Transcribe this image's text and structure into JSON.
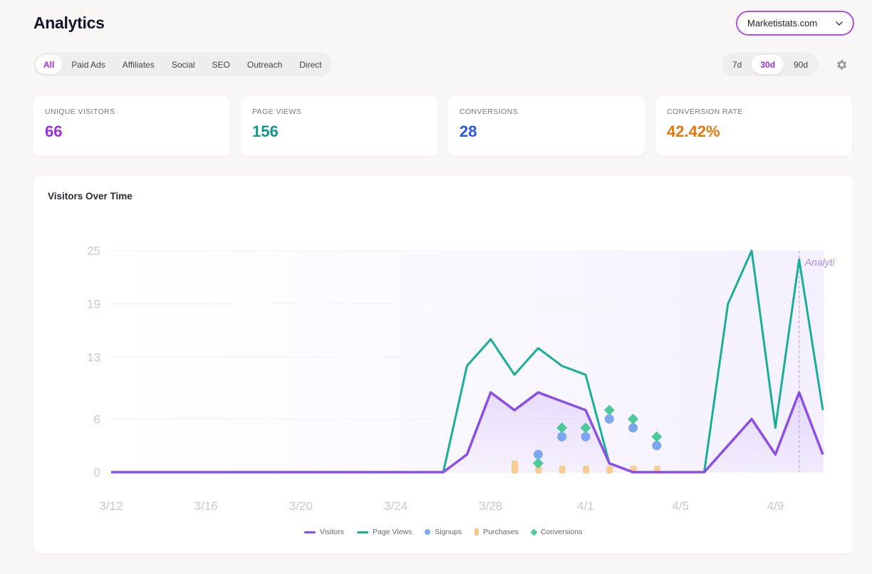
{
  "header": {
    "title": "Analytics",
    "site_select": "Marketistats.com"
  },
  "source_tabs": [
    {
      "label": "All",
      "active": true
    },
    {
      "label": "Paid Ads",
      "active": false
    },
    {
      "label": "Affiliates",
      "active": false
    },
    {
      "label": "Social",
      "active": false
    },
    {
      "label": "SEO",
      "active": false
    },
    {
      "label": "Outreach",
      "active": false
    },
    {
      "label": "Direct",
      "active": false
    }
  ],
  "range_tabs": [
    {
      "label": "7d",
      "active": false
    },
    {
      "label": "30d",
      "active": true
    },
    {
      "label": "90d",
      "active": false
    }
  ],
  "stats": [
    {
      "label": "UNIQUE VISITORS",
      "value": "66",
      "color": "#9b2ed6"
    },
    {
      "label": "PAGE VIEWS",
      "value": "156",
      "color": "#12968a"
    },
    {
      "label": "CONVERSIONS",
      "value": "28",
      "color": "#2557e0"
    },
    {
      "label": "CONVERSION RATE",
      "value": "42.42%",
      "color": "#e07a10"
    }
  ],
  "chart": {
    "title": "Visitors Over Time",
    "annotation": "Analyti",
    "legend": [
      "Visitors",
      "Page Views",
      "Signups",
      "Purchases",
      "Conversions"
    ]
  },
  "chart_data": {
    "type": "line",
    "x": [
      "3/12",
      "3/13",
      "3/14",
      "3/15",
      "3/16",
      "3/17",
      "3/18",
      "3/19",
      "3/20",
      "3/21",
      "3/22",
      "3/23",
      "3/24",
      "3/25",
      "3/26",
      "3/27",
      "3/28",
      "3/29",
      "3/30",
      "3/31",
      "4/1",
      "4/2",
      "4/3",
      "4/4",
      "4/5",
      "4/6",
      "4/7",
      "4/8",
      "4/9",
      "4/10",
      "4/11"
    ],
    "x_tick_labels": [
      "3/12",
      "3/16",
      "3/20",
      "3/24",
      "3/28",
      "4/1",
      "4/5",
      "4/9"
    ],
    "y_ticks": [
      0,
      6,
      13,
      19,
      25
    ],
    "ylim": [
      0,
      25
    ],
    "colors": {
      "visitors": "#8b4fe6",
      "page_views": "#1aae99",
      "signups": "#7ea6f0",
      "purchases": "#f5c98a",
      "conversions": "#4cc99a"
    },
    "series": [
      {
        "name": "Visitors",
        "style": "line",
        "values": [
          0,
          0,
          0,
          0,
          0,
          0,
          0,
          0,
          0,
          0,
          0,
          0,
          0,
          0,
          0,
          2,
          9,
          7,
          9,
          8,
          7,
          1,
          0,
          0,
          0,
          0,
          3,
          6,
          2,
          9,
          2
        ]
      },
      {
        "name": "Page Views",
        "style": "line",
        "values": [
          0,
          0,
          0,
          0,
          0,
          0,
          0,
          0,
          0,
          0,
          0,
          0,
          0,
          0,
          0,
          12,
          15,
          11,
          14,
          12,
          11,
          1,
          0,
          0,
          0,
          0,
          19,
          25,
          5,
          24,
          7
        ]
      },
      {
        "name": "Signups",
        "style": "dot",
        "points": [
          [
            17,
            2
          ],
          [
            18,
            4
          ],
          [
            19,
            4
          ],
          [
            20,
            6
          ],
          [
            21,
            5
          ],
          [
            22,
            3
          ]
        ]
      },
      {
        "name": "Purchases",
        "style": "bar",
        "points": [
          [
            16,
            1
          ],
          [
            17,
            0.4
          ],
          [
            18,
            0.4
          ],
          [
            19,
            0.4
          ],
          [
            20,
            0.4
          ],
          [
            21,
            0.4
          ],
          [
            22,
            0.4
          ]
        ]
      },
      {
        "name": "Conversions",
        "style": "diamond",
        "points": [
          [
            17,
            1
          ],
          [
            18,
            5
          ],
          [
            19,
            5
          ],
          [
            20,
            7
          ],
          [
            21,
            6
          ],
          [
            22,
            4
          ]
        ]
      }
    ],
    "x_offset_index_for_points": 1,
    "annotation_x": "4/9"
  }
}
